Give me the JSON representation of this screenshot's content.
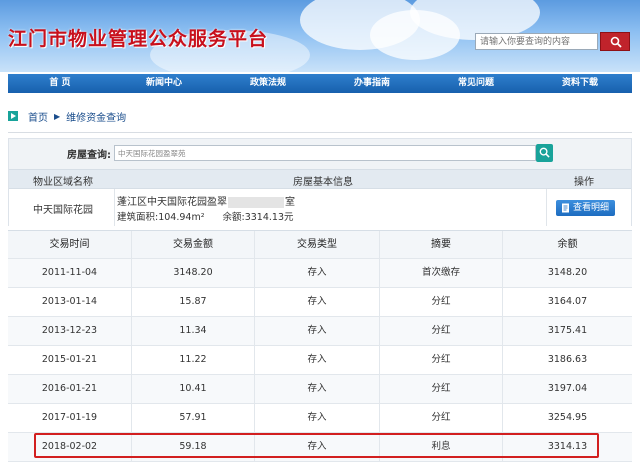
{
  "site": {
    "title": "江门市物业管理公众服务平台"
  },
  "search": {
    "placeholder": "请输入你要查询的内容"
  },
  "nav": [
    {
      "label": "首  页"
    },
    {
      "label": "新闻中心"
    },
    {
      "label": "政策法规"
    },
    {
      "label": "办事指南"
    },
    {
      "label": "常见问题"
    },
    {
      "label": "资料下载"
    }
  ],
  "breadcrumb": {
    "home": "首页",
    "current": "维修资金查询"
  },
  "query": {
    "label": "房屋查询:",
    "value": "中天国际花园盈翠苑"
  },
  "info": {
    "col_area": "物业区域名称",
    "col_basic": "房屋基本信息",
    "col_action": "操作",
    "area_name": "中天国际花园",
    "address_prefix": "蓬江区中天国际花园盈翠",
    "address_suffix": "室",
    "building_area": "建筑面积:104.94m²",
    "balance": "余额:3314.13元",
    "detail_button": "查看明细"
  },
  "table": {
    "headers": [
      "交易时间",
      "交易金额",
      "交易类型",
      "摘要",
      "余额"
    ],
    "rows": [
      [
        "2011-11-04",
        "3148.20",
        "存入",
        "首次缴存",
        "3148.20"
      ],
      [
        "2013-01-14",
        "15.87",
        "存入",
        "分红",
        "3164.07"
      ],
      [
        "2013-12-23",
        "11.34",
        "存入",
        "分红",
        "3175.41"
      ],
      [
        "2015-01-21",
        "11.22",
        "存入",
        "分红",
        "3186.63"
      ],
      [
        "2016-01-21",
        "10.41",
        "存入",
        "分红",
        "3197.04"
      ],
      [
        "2017-01-19",
        "57.91",
        "存入",
        "分红",
        "3254.95"
      ],
      [
        "2018-02-02",
        "59.18",
        "存入",
        "利息",
        "3314.13"
      ]
    ]
  },
  "colors": {
    "brand_red": "#c8101c",
    "nav_blue": "#1760ad",
    "accent_teal": "#19a39a",
    "highlight_red": "#d21f1f"
  }
}
